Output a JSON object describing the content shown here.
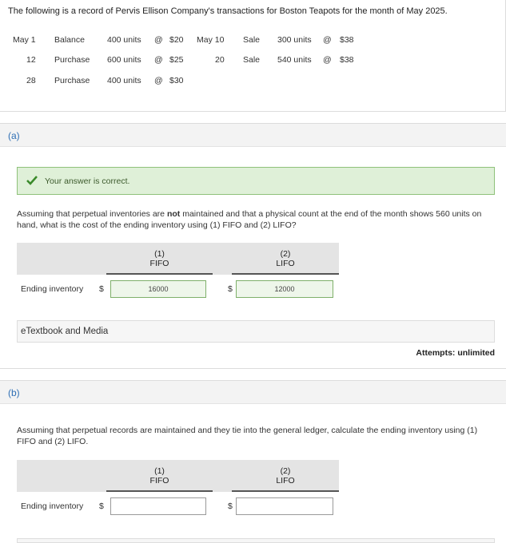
{
  "intro": {
    "text": "The following is a record of Pervis Ellison Company's transactions for Boston Teapots for the month of May 2025."
  },
  "transactions_left": [
    {
      "date": "May 1",
      "type": "Balance",
      "units": "400 units",
      "at": "@",
      "price": "$20"
    },
    {
      "date": "12",
      "type": "Purchase",
      "units": "600 units",
      "at": "@",
      "price": "$25"
    },
    {
      "date": "28",
      "type": "Purchase",
      "units": "400 units",
      "at": "@",
      "price": "$30"
    }
  ],
  "transactions_right": [
    {
      "date": "May 10",
      "type": "Sale",
      "units": "300 units",
      "at": "@",
      "price": "$38"
    },
    {
      "date": "20",
      "type": "Sale",
      "units": "540 units",
      "at": "@",
      "price": "$38"
    }
  ],
  "part_a": {
    "letter": "(a)",
    "correct_message": "Your answer is correct.",
    "question_pre": "Assuming that perpetual inventories are ",
    "question_bold": "not",
    "question_post": " maintained and that a physical count at the end of the month shows 560 units on hand, what is the cost of the ending inventory using (1) FIFO and (2) LIFO?",
    "col1_num": "(1)",
    "col1_label": "FIFO",
    "col2_num": "(2)",
    "col2_label": "LIFO",
    "row_label": "Ending inventory",
    "currency": "$",
    "fifo_value": "16000",
    "lifo_value": "12000",
    "etextbook_label": "eTextbook and Media",
    "attempts": "Attempts: unlimited"
  },
  "part_b": {
    "letter": "(b)",
    "question": "Assuming that perpetual records are maintained and they tie into the general ledger, calculate the ending inventory using (1) FIFO and (2) LIFO.",
    "col1_num": "(1)",
    "col1_label": "FIFO",
    "col2_num": "(2)",
    "col2_label": "LIFO",
    "row_label": "Ending inventory",
    "currency": "$",
    "fifo_value": "",
    "lifo_value": ""
  }
}
